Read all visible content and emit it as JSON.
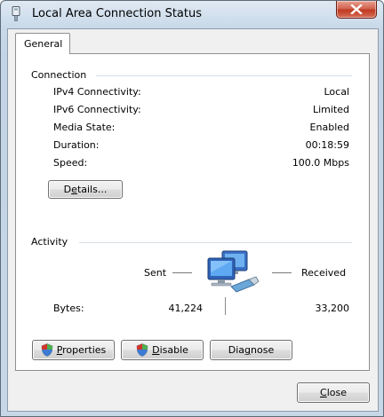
{
  "window": {
    "title": "Local Area Connection Status"
  },
  "tabs": [
    {
      "label": "General"
    }
  ],
  "connection": {
    "heading": "Connection",
    "rows": [
      {
        "label": "IPv4 Connectivity:",
        "value": "Local"
      },
      {
        "label": "IPv6 Connectivity:",
        "value": "Limited"
      },
      {
        "label": "Media State:",
        "value": "Enabled"
      },
      {
        "label": "Duration:",
        "value": "00:18:59"
      },
      {
        "label": "Speed:",
        "value": "100.0 Mbps"
      }
    ],
    "details_button": {
      "prefix": "D",
      "accel": "e",
      "suffix": "tails..."
    }
  },
  "activity": {
    "heading": "Activity",
    "sent_label": "Sent",
    "received_label": "Received",
    "bytes_label": "Bytes:",
    "bytes_sent": "41,224",
    "bytes_received": "33,200"
  },
  "buttons": {
    "properties": {
      "accel": "P",
      "rest": "roperties"
    },
    "disable": {
      "accel": "D",
      "rest": "isable"
    },
    "diagnose": {
      "prefix": "Dia",
      "accel": "g",
      "rest": "nose"
    },
    "close": {
      "accel": "C",
      "rest": "lose"
    }
  },
  "icons": {
    "title": "network-adapter-icon",
    "close": "close-icon",
    "network": "network-computers-icon",
    "shield": "uac-shield-icon"
  }
}
